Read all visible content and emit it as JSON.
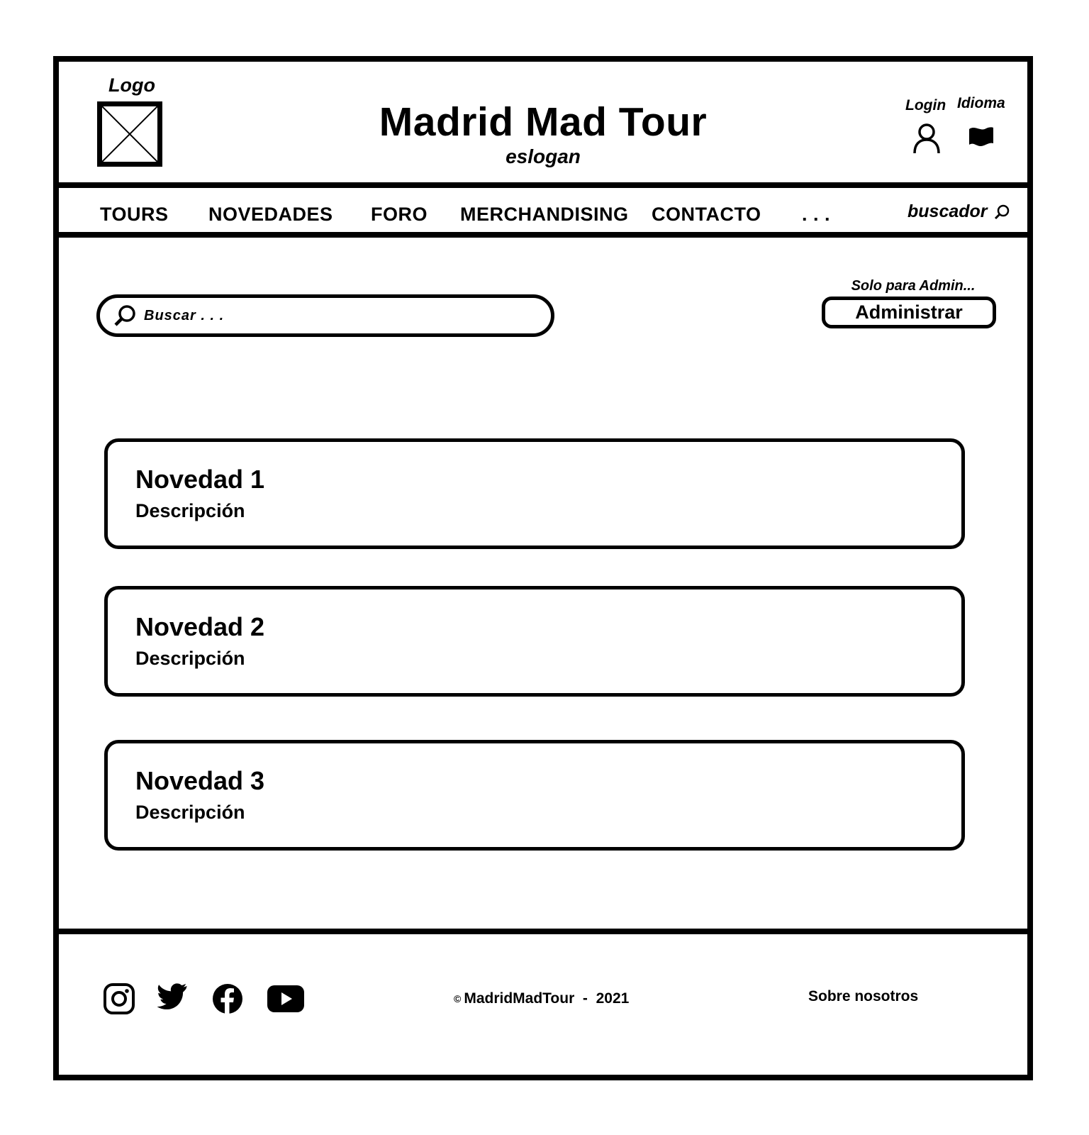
{
  "header": {
    "logo_label": "Logo",
    "title": "Madrid Mad Tour",
    "slogan": "eslogan",
    "login_label": "Login",
    "language_label": "Idioma"
  },
  "nav": {
    "items": [
      "TOURS",
      "NOVEDADES",
      "FORO",
      "MERCHANDISING",
      "CONTACTO",
      ". . ."
    ],
    "search_label": "buscador"
  },
  "main": {
    "search": {
      "placeholder": "Buscar . . ."
    },
    "admin_note": "Solo para Admin...",
    "admin_button": "Administrar",
    "cards": [
      {
        "title": "Novedad 1",
        "description": "Descripción"
      },
      {
        "title": "Novedad 2",
        "description": "Descripción"
      },
      {
        "title": "Novedad 3",
        "description": "Descripción"
      }
    ]
  },
  "footer": {
    "social_icons": [
      "instagram-icon",
      "twitter-icon",
      "facebook-icon",
      "youtube-icon"
    ],
    "copyright_symbol": "©",
    "copyright": "MadridMadTour  -  2021",
    "about": "Sobre nosotros"
  }
}
